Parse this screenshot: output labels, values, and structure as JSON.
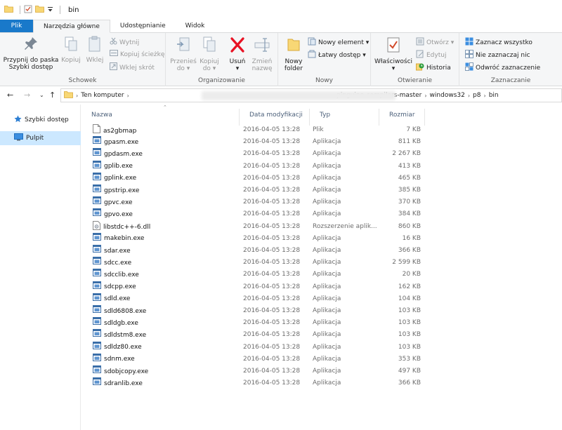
{
  "window": {
    "title": "bin"
  },
  "tabs": [
    {
      "label": "Plik"
    },
    {
      "label": "Narzędzia główne"
    },
    {
      "label": "Udostępnianie"
    },
    {
      "label": "Widok"
    }
  ],
  "ribbon": {
    "clipboard": {
      "group_label": "Schowek",
      "pin_label_1": "Przypnij do paska",
      "pin_label_2": "Szybki dostęp",
      "copy_label": "Kopiuj",
      "paste_label": "Wklej",
      "cut_label": "Wytnij",
      "copy_path_label": "Kopiuj ścieżkę",
      "paste_shortcut_label": "Wklej skrót"
    },
    "organize": {
      "group_label": "Organizowanie",
      "move_to_label_1": "Przenieś",
      "move_to_label_2": "do",
      "copy_to_label_1": "Kopiuj",
      "copy_to_label_2": "do",
      "delete_label": "Usuń",
      "rename_label_1": "Zmień",
      "rename_label_2": "nazwę"
    },
    "new": {
      "group_label": "Nowy",
      "new_folder_label_1": "Nowy",
      "new_folder_label_2": "folder",
      "new_item_label": "Nowy element",
      "easy_access_label": "Łatwy dostęp"
    },
    "open": {
      "group_label": "Otwieranie",
      "properties_label": "Właściwości",
      "open_label": "Otwórz",
      "edit_label": "Edytuj",
      "history_label": "Historia"
    },
    "select": {
      "group_label": "Zaznaczanie",
      "select_all_label": "Zaznacz wszystko",
      "select_none_label": "Nie zaznaczaj nic",
      "invert_label": "Odwróć zaznaczenie"
    }
  },
  "address": {
    "crumbs": [
      "Ten komputer",
      "pinguino-compilers-master",
      "windows32",
      "p8",
      "bin"
    ]
  },
  "nav": {
    "items": [
      {
        "label": "Szybki dostęp",
        "icon": "star-icon"
      },
      {
        "label": "Pulpit",
        "icon": "desktop-icon"
      }
    ]
  },
  "list": {
    "columns": {
      "name": "Nazwa",
      "date": "Data modyfikacji",
      "type": "Typ",
      "size": "Rozmiar"
    },
    "rows": [
      {
        "name": "as2gbmap",
        "date": "2016-04-05 13:28",
        "type": "Plik",
        "size": "7 KB",
        "icon": "file"
      },
      {
        "name": "gpasm.exe",
        "date": "2016-04-05 13:28",
        "type": "Aplikacja",
        "size": "811 KB",
        "icon": "exe"
      },
      {
        "name": "gpdasm.exe",
        "date": "2016-04-05 13:28",
        "type": "Aplikacja",
        "size": "2 267 KB",
        "icon": "exe"
      },
      {
        "name": "gplib.exe",
        "date": "2016-04-05 13:28",
        "type": "Aplikacja",
        "size": "413 KB",
        "icon": "exe"
      },
      {
        "name": "gplink.exe",
        "date": "2016-04-05 13:28",
        "type": "Aplikacja",
        "size": "465 KB",
        "icon": "exe"
      },
      {
        "name": "gpstrip.exe",
        "date": "2016-04-05 13:28",
        "type": "Aplikacja",
        "size": "385 KB",
        "icon": "exe"
      },
      {
        "name": "gpvc.exe",
        "date": "2016-04-05 13:28",
        "type": "Aplikacja",
        "size": "370 KB",
        "icon": "exe"
      },
      {
        "name": "gpvo.exe",
        "date": "2016-04-05 13:28",
        "type": "Aplikacja",
        "size": "384 KB",
        "icon": "exe"
      },
      {
        "name": "libstdc++-6.dll",
        "date": "2016-04-05 13:28",
        "type": "Rozszerzenie aplik...",
        "size": "860 KB",
        "icon": "dll"
      },
      {
        "name": "makebin.exe",
        "date": "2016-04-05 13:28",
        "type": "Aplikacja",
        "size": "16 KB",
        "icon": "exe"
      },
      {
        "name": "sdar.exe",
        "date": "2016-04-05 13:28",
        "type": "Aplikacja",
        "size": "366 KB",
        "icon": "exe"
      },
      {
        "name": "sdcc.exe",
        "date": "2016-04-05 13:28",
        "type": "Aplikacja",
        "size": "2 599 KB",
        "icon": "exe"
      },
      {
        "name": "sdcclib.exe",
        "date": "2016-04-05 13:28",
        "type": "Aplikacja",
        "size": "20 KB",
        "icon": "exe"
      },
      {
        "name": "sdcpp.exe",
        "date": "2016-04-05 13:28",
        "type": "Aplikacja",
        "size": "162 KB",
        "icon": "exe"
      },
      {
        "name": "sdld.exe",
        "date": "2016-04-05 13:28",
        "type": "Aplikacja",
        "size": "104 KB",
        "icon": "exe"
      },
      {
        "name": "sdld6808.exe",
        "date": "2016-04-05 13:28",
        "type": "Aplikacja",
        "size": "103 KB",
        "icon": "exe"
      },
      {
        "name": "sdldgb.exe",
        "date": "2016-04-05 13:28",
        "type": "Aplikacja",
        "size": "103 KB",
        "icon": "exe"
      },
      {
        "name": "sdldstm8.exe",
        "date": "2016-04-05 13:28",
        "type": "Aplikacja",
        "size": "103 KB",
        "icon": "exe"
      },
      {
        "name": "sdldz80.exe",
        "date": "2016-04-05 13:28",
        "type": "Aplikacja",
        "size": "103 KB",
        "icon": "exe"
      },
      {
        "name": "sdnm.exe",
        "date": "2016-04-05 13:28",
        "type": "Aplikacja",
        "size": "353 KB",
        "icon": "exe"
      },
      {
        "name": "sdobjcopy.exe",
        "date": "2016-04-05 13:28",
        "type": "Aplikacja",
        "size": "497 KB",
        "icon": "exe"
      },
      {
        "name": "sdranlib.exe",
        "date": "2016-04-05 13:28",
        "type": "Aplikacja",
        "size": "366 KB",
        "icon": "exe"
      }
    ]
  },
  "colors": {
    "accent": "#1979ca",
    "selected_bg": "#cce8ff",
    "header_text": "#4c607a"
  }
}
